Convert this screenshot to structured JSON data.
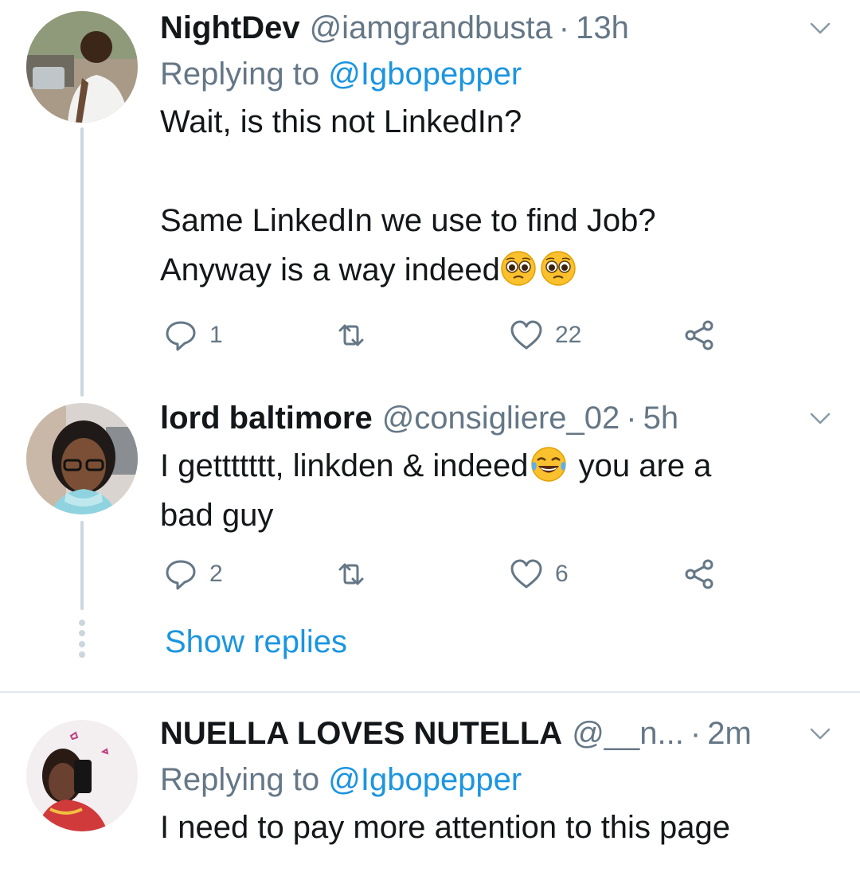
{
  "tweets": [
    {
      "name": "NightDev",
      "handle": "@iamgrandbusta",
      "time": "13h",
      "replying_prefix": "Replying to ",
      "replying_mention": "@Igbopepper",
      "body_line1": "Wait, is this not LinkedIn?",
      "body_line2": "Same LinkedIn we use to find Job?",
      "body_line3": "Anyway is a way indeed",
      "reply_count": "1",
      "retweet_count": "",
      "like_count": "22"
    },
    {
      "name": "lord baltimore",
      "handle": "@consigliere_02",
      "time": "5h",
      "body_part1": "I gettttttt, linkden  & indeed",
      "body_part2": " you are a",
      "body_line2": "bad guy",
      "reply_count": "2",
      "retweet_count": "",
      "like_count": "6"
    },
    {
      "name": "NUELLA LOVES NUTELLA",
      "handle": "@__n...",
      "time": "2m",
      "replying_prefix": "Replying to ",
      "replying_mention": "@Igbopepper",
      "body_line1": "I need to pay more attention to this page"
    }
  ],
  "show_replies_label": "Show replies",
  "icons": {
    "reply": "reply-icon",
    "retweet": "retweet-icon",
    "like": "heart-icon",
    "share": "share-icon",
    "caret": "chevron-down-icon",
    "emoji_pleading": "pleading-face-emoji",
    "emoji_laughing": "tears-of-joy-emoji"
  },
  "colors": {
    "link": "#1b95e0",
    "secondary": "#657786",
    "text": "#14171a",
    "thread": "#ccd6dd"
  }
}
